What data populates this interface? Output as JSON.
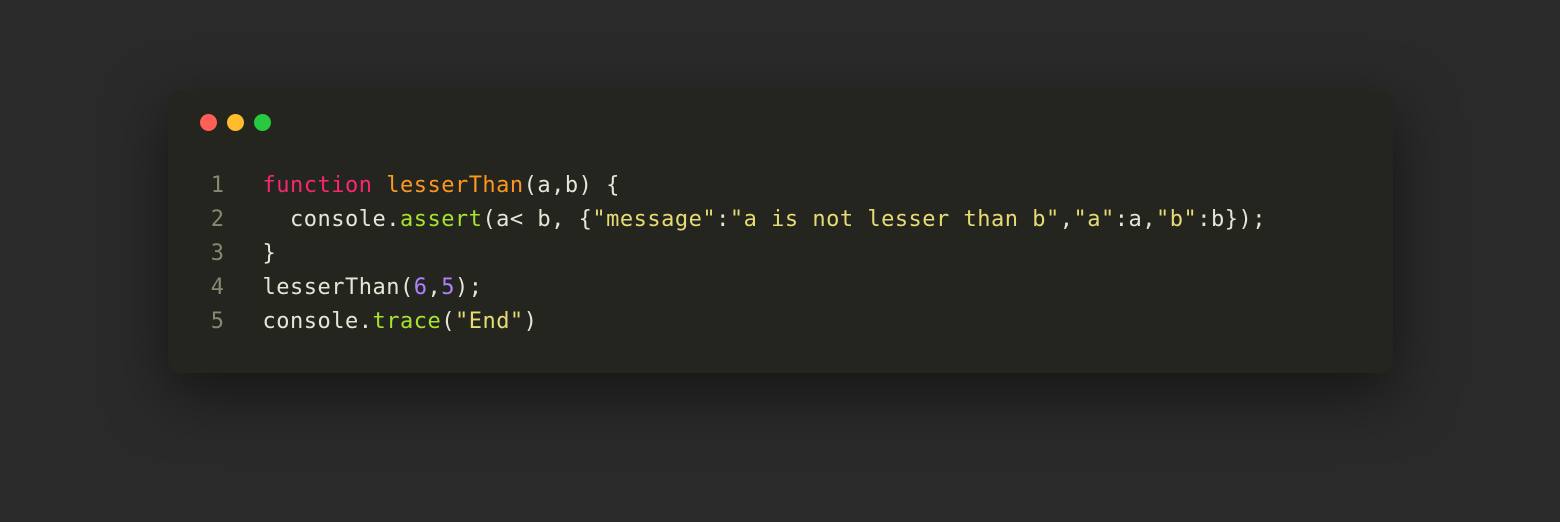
{
  "traffic_lights": [
    "red",
    "yellow",
    "green"
  ],
  "code": {
    "lines": [
      {
        "no": "1",
        "tokens": [
          {
            "cls": "tok-keyword",
            "t": "function"
          },
          {
            "cls": "tok-default",
            "t": " "
          },
          {
            "cls": "tok-funcname",
            "t": "lesserThan"
          },
          {
            "cls": "tok-default",
            "t": "(a,b) {"
          }
        ]
      },
      {
        "no": "2",
        "tokens": [
          {
            "cls": "tok-default",
            "t": "  console."
          },
          {
            "cls": "tok-ident",
            "t": "assert"
          },
          {
            "cls": "tok-default",
            "t": "(a< b, {"
          },
          {
            "cls": "tok-string",
            "t": "\"message\""
          },
          {
            "cls": "tok-default",
            "t": ":"
          },
          {
            "cls": "tok-string",
            "t": "\"a is not lesser than b\""
          },
          {
            "cls": "tok-default",
            "t": ","
          },
          {
            "cls": "tok-string",
            "t": "\"a\""
          },
          {
            "cls": "tok-default",
            "t": ":a,"
          },
          {
            "cls": "tok-string",
            "t": "\"b\""
          },
          {
            "cls": "tok-default",
            "t": ":b});"
          }
        ]
      },
      {
        "no": "3",
        "tokens": [
          {
            "cls": "tok-default",
            "t": "}"
          }
        ]
      },
      {
        "no": "4",
        "tokens": [
          {
            "cls": "tok-default",
            "t": "lesserThan("
          },
          {
            "cls": "tok-number",
            "t": "6"
          },
          {
            "cls": "tok-default",
            "t": ","
          },
          {
            "cls": "tok-number",
            "t": "5"
          },
          {
            "cls": "tok-default",
            "t": ");"
          }
        ]
      },
      {
        "no": "5",
        "tokens": [
          {
            "cls": "tok-default",
            "t": "console."
          },
          {
            "cls": "tok-ident",
            "t": "trace"
          },
          {
            "cls": "tok-default",
            "t": "("
          },
          {
            "cls": "tok-string",
            "t": "\"End\""
          },
          {
            "cls": "tok-default",
            "t": ")"
          }
        ]
      }
    ]
  }
}
